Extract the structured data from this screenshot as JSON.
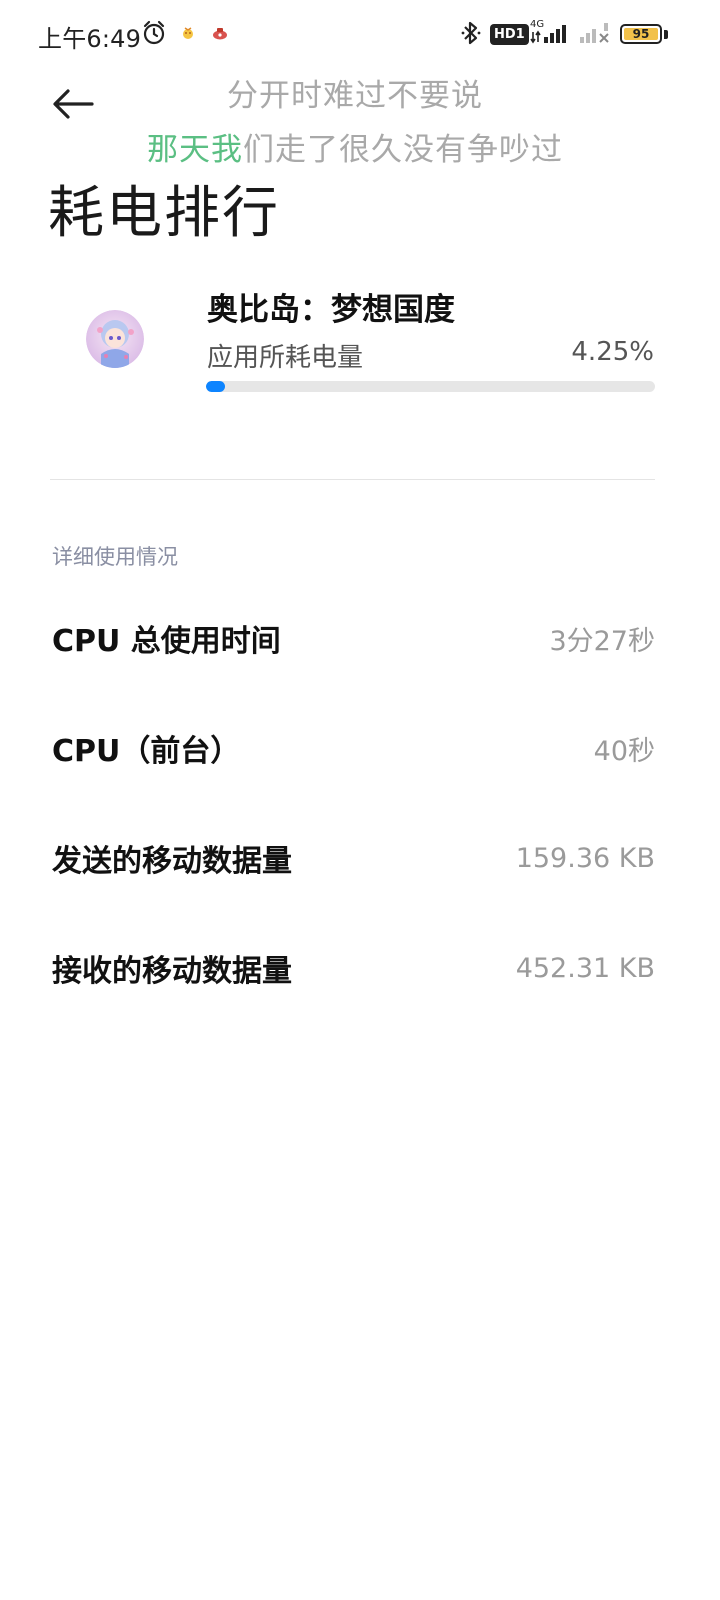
{
  "status_bar": {
    "time": "上午6:49",
    "hd_badge": "HD1",
    "network": "4G",
    "battery": "95"
  },
  "lyrics": {
    "line1": "分开时难过不要说",
    "line2_highlight": "那天我",
    "line2_rest": "们走了很久没有争吵过"
  },
  "header": {
    "title": "耗电排行"
  },
  "app": {
    "name": "奥比岛：梦想国度",
    "usage_label": "应用所耗电量",
    "usage_value": "4.25%",
    "usage_fraction": 0.0425
  },
  "details": {
    "section_title": "详细使用情况",
    "rows": [
      {
        "label": "CPU 总使用时间",
        "value": "3分27秒"
      },
      {
        "label": "CPU（前台）",
        "value": "40秒"
      },
      {
        "label": "发送的移动数据量",
        "value": "159.36 KB"
      },
      {
        "label": "接收的移动数据量",
        "value": "452.31 KB"
      }
    ]
  },
  "colors": {
    "accent": "#0d84ff",
    "lyric_highlight": "#5bbf83"
  }
}
